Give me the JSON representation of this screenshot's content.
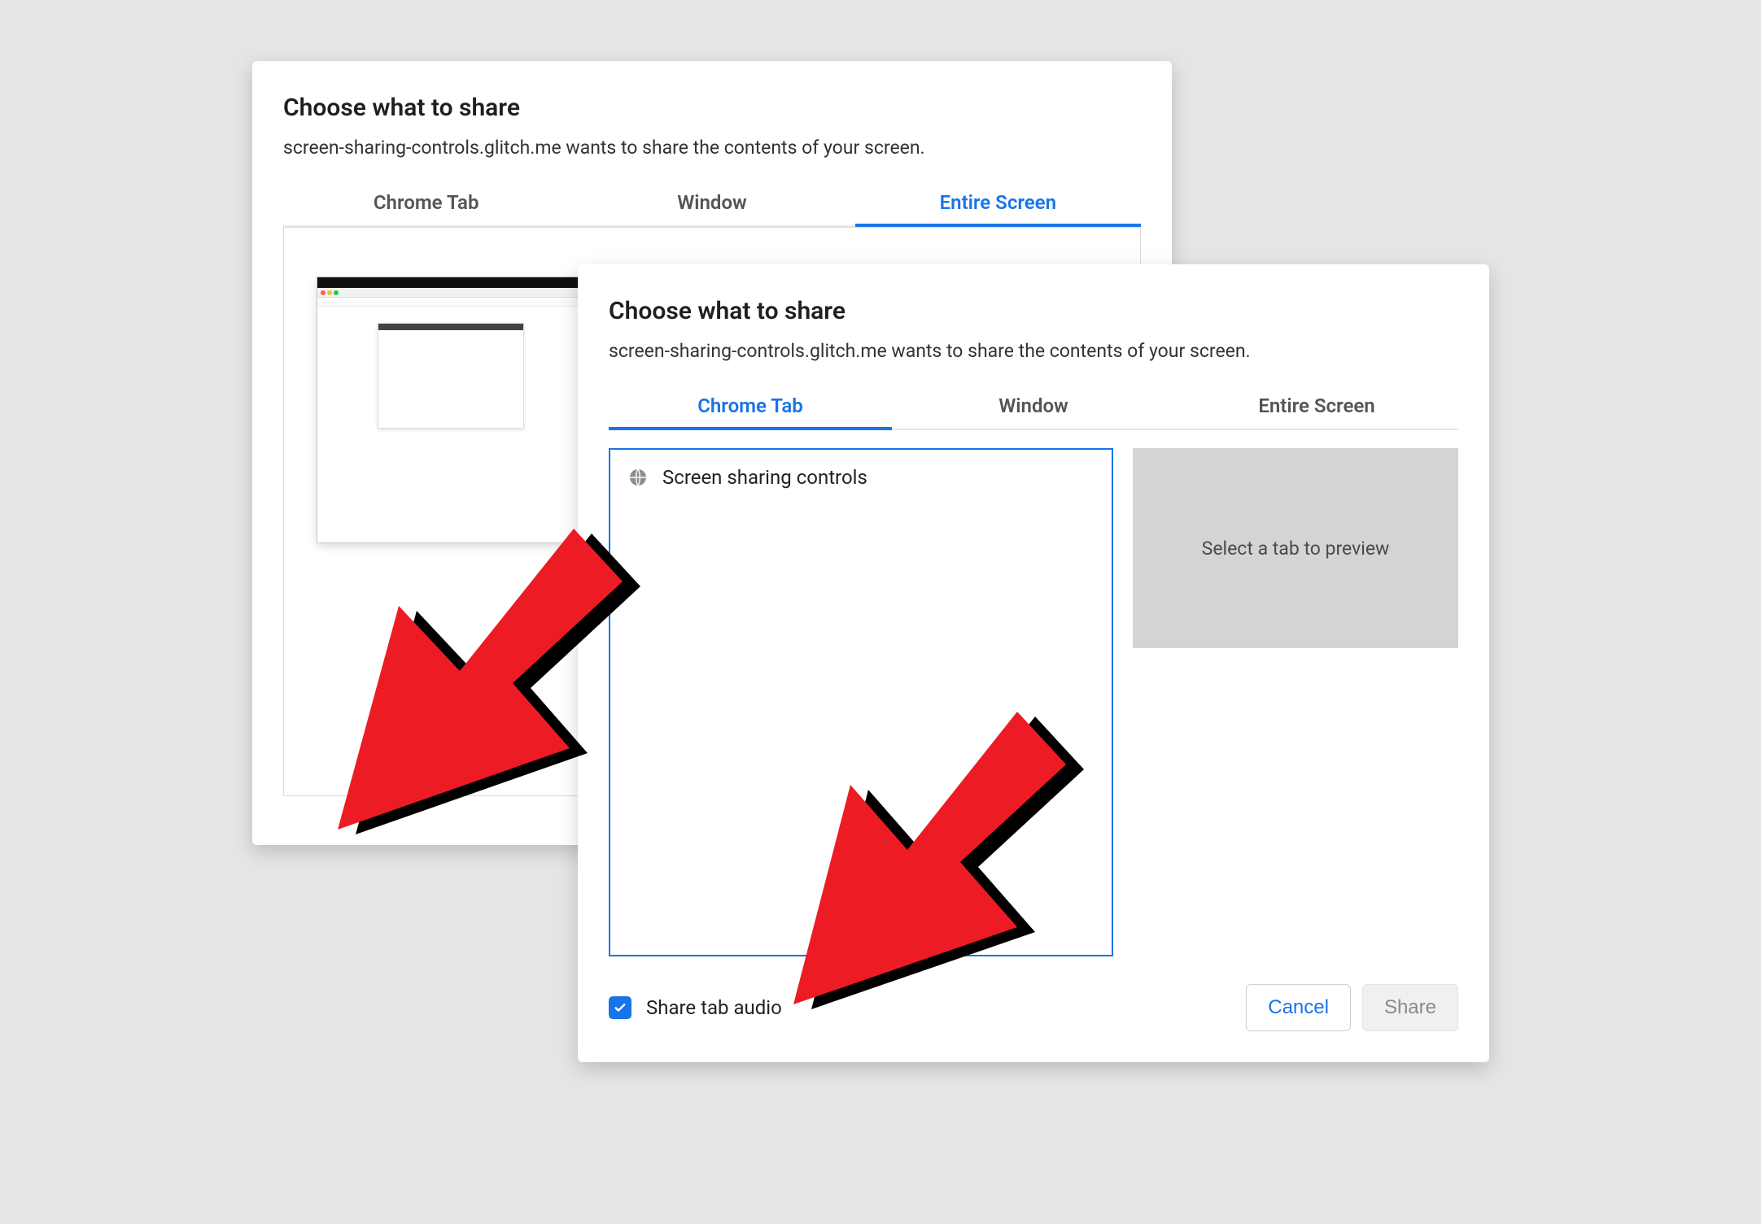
{
  "back_dialog": {
    "title": "Choose what to share",
    "subtitle": "screen-sharing-controls.glitch.me wants to share the contents of your screen.",
    "tabs": [
      {
        "label": "Chrome Tab",
        "active": false
      },
      {
        "label": "Window",
        "active": false
      },
      {
        "label": "Entire Screen",
        "active": true
      }
    ]
  },
  "front_dialog": {
    "title": "Choose what to share",
    "subtitle": "screen-sharing-controls.glitch.me wants to share the contents of your screen.",
    "tabs": [
      {
        "label": "Chrome Tab",
        "active": true
      },
      {
        "label": "Window",
        "active": false
      },
      {
        "label": "Entire Screen",
        "active": false
      }
    ],
    "tab_list": [
      {
        "icon": "globe-icon",
        "label": "Screen sharing controls"
      }
    ],
    "preview_placeholder": "Select a tab to preview",
    "share_audio_label": "Share tab audio",
    "share_audio_checked": true,
    "cancel_label": "Cancel",
    "share_label": "Share"
  },
  "colors": {
    "accent": "#1a73e8"
  }
}
